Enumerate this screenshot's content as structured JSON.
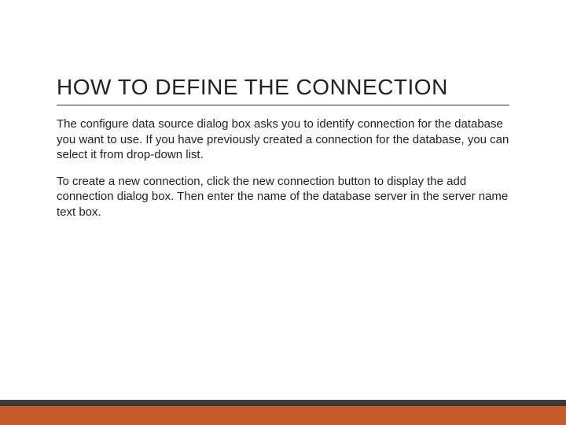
{
  "title": "HOW TO DEFINE THE CONNECTION",
  "paragraph1": "The configure data source dialog box asks you to identify connection for the database you want to use. If you have previously created a connection for the database, you can select it from drop-down list.",
  "paragraph2": "To create a new connection, click the new connection button to display the add connection dialog box. Then enter the name of the database server in the server name text box."
}
